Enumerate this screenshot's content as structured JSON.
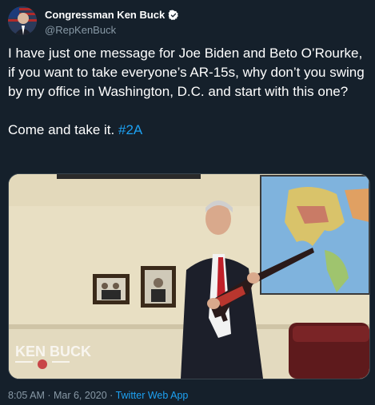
{
  "author": {
    "display_name": "Congressman Ken Buck",
    "handle": "@RepKenBuck"
  },
  "tweet": {
    "text_line1": "I have just one message for Joe Biden and Beto O’Rourke, if you want to take everyone’s AR-15s, why don’t you swing by my office in Washington, D.C. and start with this one?",
    "text_line2": "Come and take it.",
    "hashtag": "#2A"
  },
  "media": {
    "watermark": "KEN BUCK"
  },
  "footer": {
    "timestamp": "8:05 AM · Mar 6, 2020 · ",
    "source": "Twitter Web App"
  },
  "colors": {
    "background": "#15202b",
    "link": "#1da1f2",
    "secondary_text": "#8899a6",
    "verified": "#ffffff"
  }
}
